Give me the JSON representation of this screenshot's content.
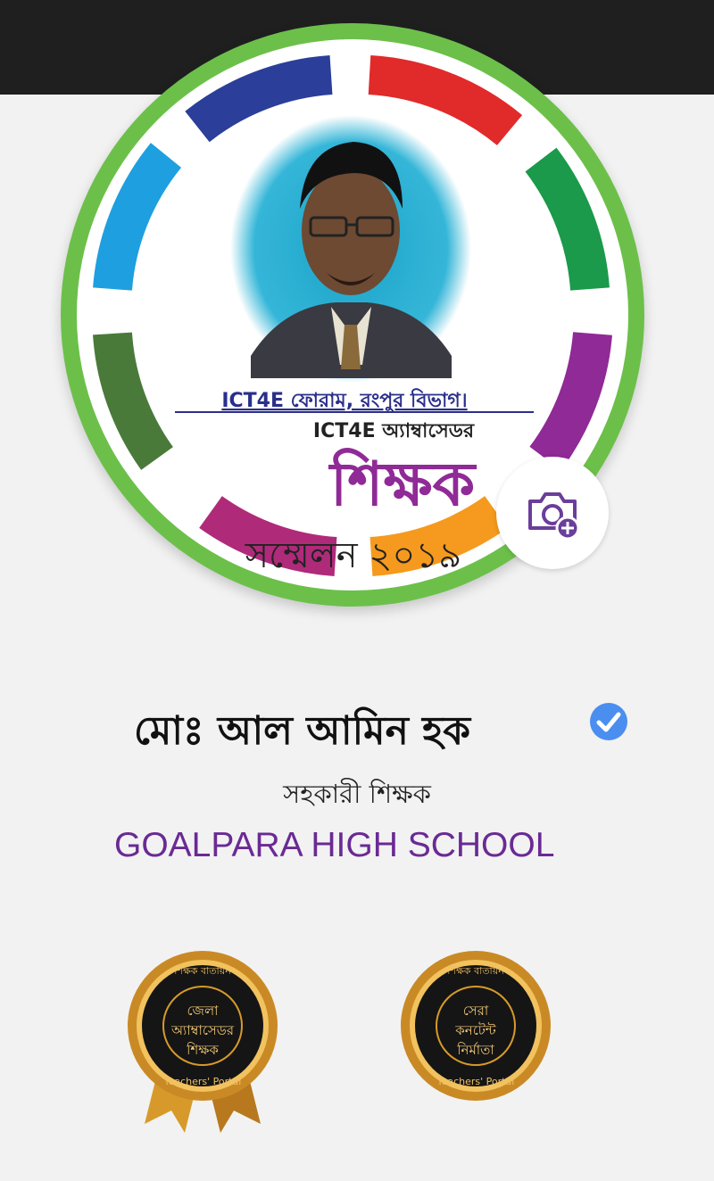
{
  "profile": {
    "name": "মোঃ আল আমিন হক",
    "designation": "সহকারী শিক্ষক",
    "school": "GOALPARA HIGH SCHOOL",
    "verified": true
  },
  "cover_art": {
    "line1": "ICT4E ফোরাম, রংপুর বিভাগ।",
    "line2": "ICT4E অ্যাম্বাসেডর",
    "line3": "শিক্ষক",
    "line4": "সম্মেলন ২০১৯"
  },
  "badges": [
    {
      "arc_top": "শিক্ষক বাতায়ন",
      "lines": [
        "জেলা",
        "অ্যাম্বাসেডর",
        "শিক্ষক"
      ],
      "arc_bottom": "Teachers' Portal"
    },
    {
      "arc_top": "শিক্ষক বাতায়ন",
      "lines": [
        "সেরা",
        "কনটেন্ট",
        "নির্মাতা"
      ],
      "arc_bottom": "Teachers' Portal"
    }
  ],
  "colors": {
    "ring": "#6cc04a",
    "school": "#6a2a94",
    "verified": "#4a8ef0",
    "camera": "#6a3e9a"
  },
  "icons": {
    "camera": "camera-plus-icon",
    "verified": "verified-check-icon"
  }
}
